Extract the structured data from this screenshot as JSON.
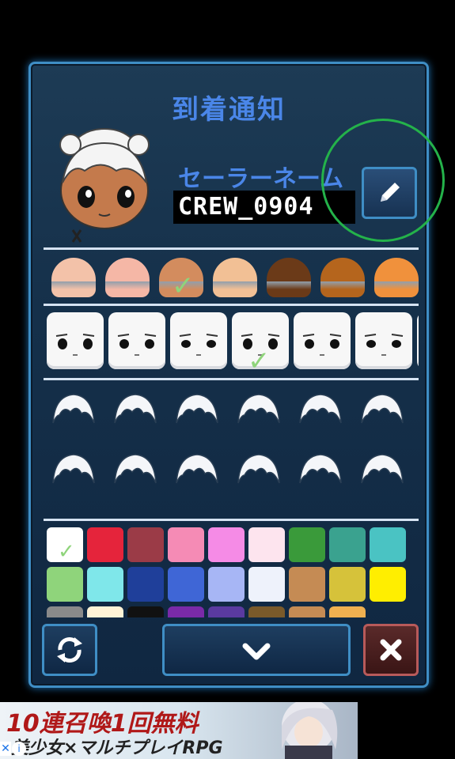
{
  "dialog": {
    "title": "到着通知",
    "name_label": "セーラーネーム",
    "name_value": "CREW_0904"
  },
  "skin_tones": [
    "#f3c2a9",
    "#f5b7a6",
    "#d38c5e",
    "#f2c095",
    "#6b3a18",
    "#b5651d",
    "#f0913c"
  ],
  "skin_selected_index": 2,
  "face_selected_index": 3,
  "hair_selected_index": 0,
  "hair_colors": [
    "#ffffff",
    "#e5243b",
    "#9b3b47",
    "#f58bb5",
    "#f58be6",
    "#fde4ee",
    "#3a9a3a",
    "#3aa28f",
    "#4ac3c3",
    "#8fd47b",
    "#7fe7ea",
    "#1f3f9a",
    "#3f66d6",
    "#a7b6f5",
    "#eef2fb",
    "#c58b54",
    "#d6c23a",
    "#ffee00",
    "#8a8a8a",
    "#fff3d6",
    "#111111",
    "#7a2aa8",
    "#5a3aa0",
    "#7a5a2a",
    "#c58b54",
    "#f0b050"
  ],
  "hair_color_selected_index": 0,
  "buttons": {
    "refresh_icon": "refresh-icon",
    "confirm_icon": "checkmark-icon",
    "close_icon": "close-icon",
    "edit_icon": "pencil-icon"
  },
  "ad": {
    "line1": "10連召喚1回無料",
    "line2": "美少女×マルチプレイRPG",
    "close": "✕",
    "info": "i"
  }
}
